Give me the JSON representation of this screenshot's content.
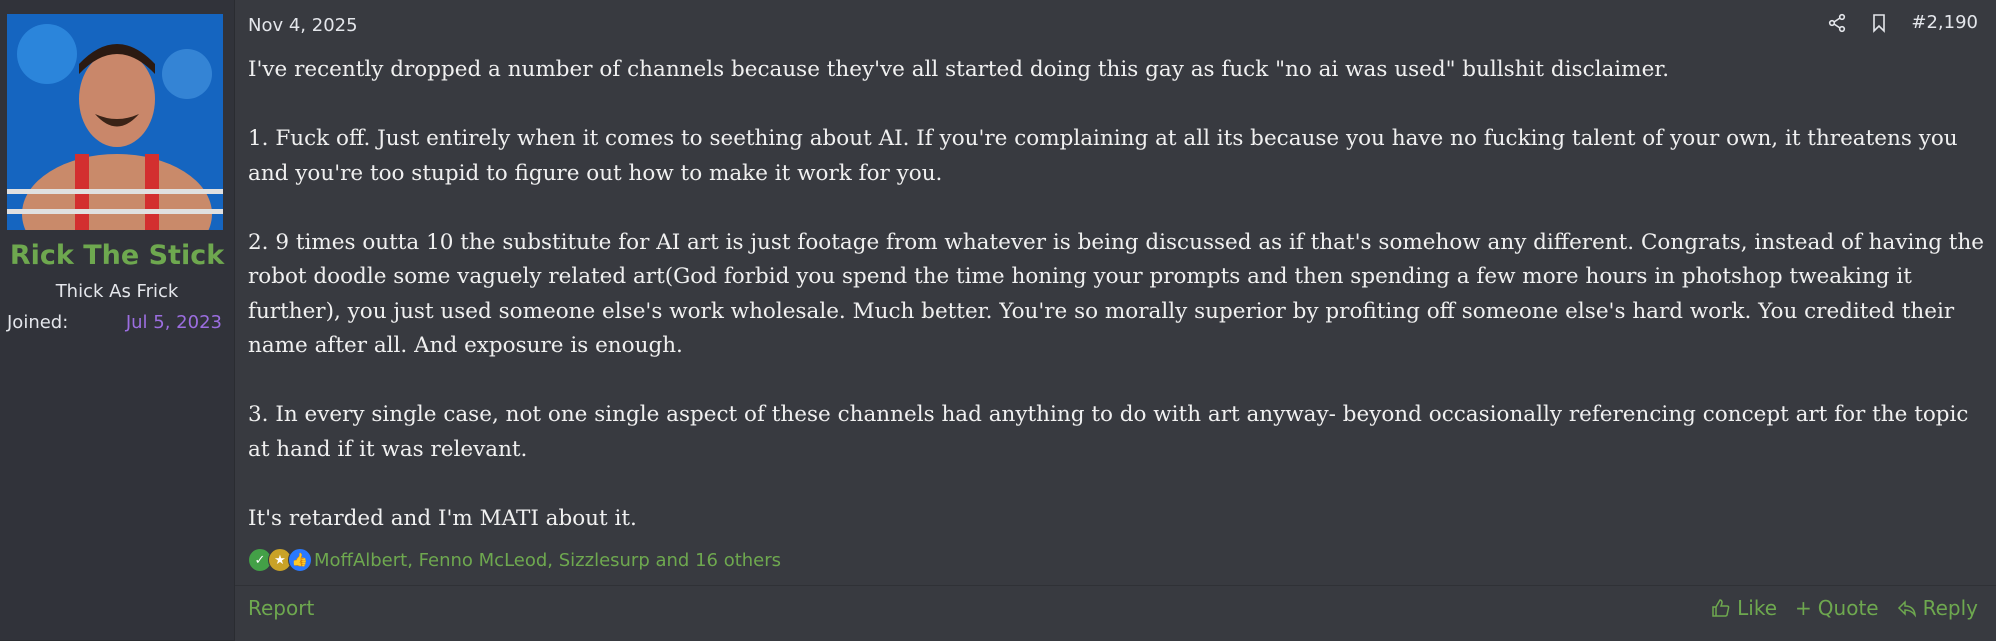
{
  "user": {
    "name": "Rick The Stick",
    "title": "Thick As Frick",
    "joined_label": "Joined:",
    "joined_date": "Jul 5, 2023",
    "avatar_icon": "wrestler-avatar"
  },
  "post": {
    "date": "Nov 4, 2025",
    "number": "#2,190",
    "paragraphs": [
      "I've recently dropped a number of channels because they've all started doing this gay as fuck \"no ai was used\" bullshit disclaimer.",
      "1. Fuck off. Just entirely when it comes to seething about AI. If you're complaining at all its because you have no fucking talent of your own, it threatens you and you're too stupid to figure out how to make it work for you.",
      "2. 9 times outta 10 the substitute for AI art is just footage from whatever is being discussed as if that's somehow any different. Congrats, instead of having the robot doodle some vaguely related art(God forbid you spend the time honing your prompts and then spending a few more hours in photshop tweaking it further), you just used someone else's work wholesale. Much better. You're so morally superior by profiting off someone else's hard work. You credited their name after all. And exposure is enough.",
      "3. In every single case, not one single aspect of these channels had anything to do with art anyway- beyond occasionally referencing concept art for the topic at hand if it was relevant.",
      "It's retarded and I'm MATI about it."
    ],
    "reactions_text": "MoffAlbert, Fenno McLeod, Sizzlesurp and 16 others"
  },
  "footer": {
    "report": "Report",
    "like": "Like",
    "quote": "Quote",
    "reply": "Reply"
  },
  "colors": {
    "username": "#6ea84f",
    "joined_date": "#9c6ee0",
    "link": "#6ea84f"
  }
}
